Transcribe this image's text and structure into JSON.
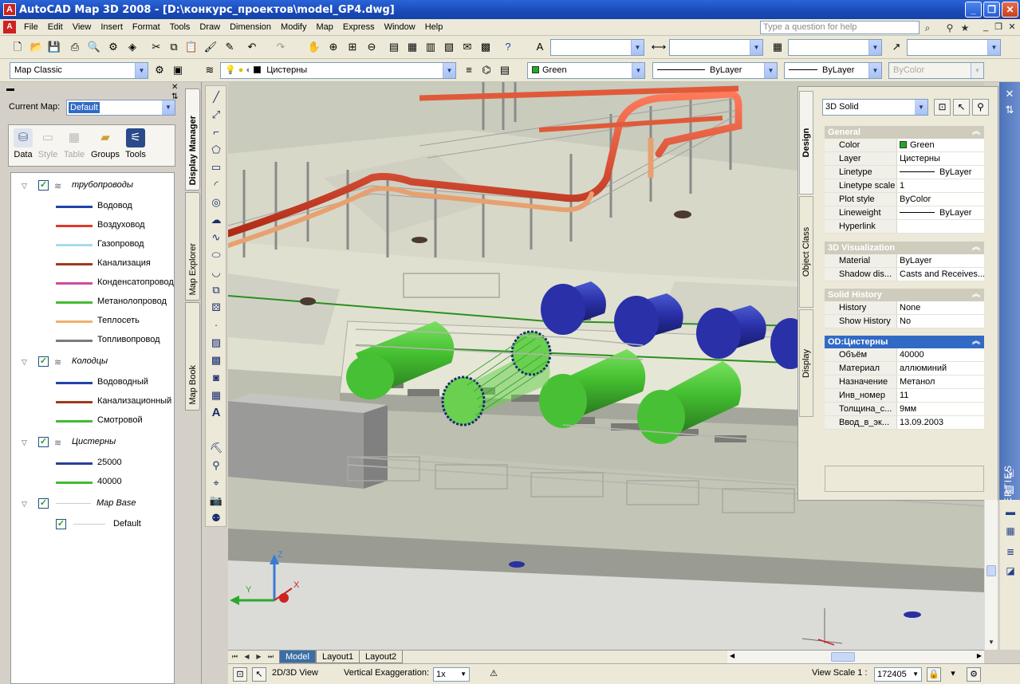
{
  "window": {
    "title": "AutoCAD Map 3D 2008 - [D:\\конкурс_проектов\\model_GP4.dwg]",
    "app_icon": "A",
    "buttons": [
      "_",
      "❐",
      "✕"
    ]
  },
  "menubar": {
    "items": [
      "File",
      "Edit",
      "View",
      "Insert",
      "Format",
      "Tools",
      "Draw",
      "Dimension",
      "Modify",
      "Map",
      "Express",
      "Window",
      "Help"
    ],
    "help_placeholder": "Type a question for help"
  },
  "toolbar2": {
    "workspace": "Map Classic",
    "layer": "Цистерны",
    "color": "Green",
    "color_hex": "#22aa22",
    "linetype": "ByLayer",
    "lineweight": "ByLayer",
    "plotstyle": "ByColor"
  },
  "display_manager": {
    "tab_label": "Display Manager",
    "current_map_label": "Current Map:",
    "current_map_value": "Default",
    "tools": [
      {
        "label": "Data",
        "icon": "database-icon"
      },
      {
        "label": "Style",
        "icon": "style-icon"
      },
      {
        "label": "Table",
        "icon": "table-icon"
      },
      {
        "label": "Groups",
        "icon": "groups-icon"
      },
      {
        "label": "Tools",
        "icon": "tools-icon"
      }
    ],
    "groups": [
      {
        "name": "трубопроводы",
        "items": [
          {
            "label": "Водовод",
            "color": "#2244aa"
          },
          {
            "label": "Воздуховод",
            "color": "#e03a2a"
          },
          {
            "label": "Газопровод",
            "color": "#a8dbe8"
          },
          {
            "label": "Канализация",
            "color": "#a03a1a"
          },
          {
            "label": "Конденсатопровод",
            "color": "#d04aa0"
          },
          {
            "label": "Метанолопровод",
            "color": "#44bb33"
          },
          {
            "label": "Теплосеть",
            "color": "#f0b070"
          },
          {
            "label": "Топливопровод",
            "color": "#7a7a7a"
          }
        ]
      },
      {
        "name": "Колодцы",
        "items": [
          {
            "label": "Водоводный",
            "color": "#2244aa"
          },
          {
            "label": "Канализационный",
            "color": "#a03a1a"
          },
          {
            "label": "Смотровой",
            "color": "#44bb33"
          }
        ]
      },
      {
        "name": "Цистерны",
        "items": [
          {
            "label": "25000",
            "color": "#2a3f9a"
          },
          {
            "label": "40000",
            "color": "#44bb33"
          }
        ]
      },
      {
        "name": "Map Base",
        "items": [
          {
            "label": "Default",
            "color": "#cccccc"
          }
        ]
      }
    ]
  },
  "side_tabs": {
    "map_explorer": "Map Explorer",
    "map_book": "Map Book"
  },
  "properties": {
    "object_type": "3D Solid",
    "tabs": [
      "Design",
      "Object Class",
      "Display"
    ],
    "strip_title": "PROPERTIES",
    "sections": [
      {
        "title": "General",
        "rows": [
          {
            "key": "Color",
            "value": "Green",
            "swatch": "#22aa22"
          },
          {
            "key": "Layer",
            "value": "Цистерны"
          },
          {
            "key": "Linetype",
            "value": "ByLayer",
            "line": true
          },
          {
            "key": "Linetype scale",
            "value": "1"
          },
          {
            "key": "Plot style",
            "value": "ByColor"
          },
          {
            "key": "Lineweight",
            "value": "ByLayer",
            "line": true
          },
          {
            "key": "Hyperlink",
            "value": ""
          }
        ]
      },
      {
        "title": "3D Visualization",
        "rows": [
          {
            "key": "Material",
            "value": "ByLayer"
          },
          {
            "key": "Shadow dis...",
            "value": "Casts and Receives..."
          }
        ]
      },
      {
        "title": "Solid History",
        "rows": [
          {
            "key": "History",
            "value": "None"
          },
          {
            "key": "Show History",
            "value": "No"
          }
        ]
      },
      {
        "title": "OD:Цистерны",
        "selected": true,
        "rows": [
          {
            "key": "Объём",
            "value": "40000"
          },
          {
            "key": "Материал",
            "value": "аллюминий"
          },
          {
            "key": "Назначение",
            "value": "Метанол"
          },
          {
            "key": "Инв_номер",
            "value": "11"
          },
          {
            "key": "Толщина_с...",
            "value": "9мм"
          },
          {
            "key": "Ввод_в_эк...",
            "value": "13.09.2003"
          }
        ]
      }
    ]
  },
  "layout_tabs": [
    "Model",
    "Layout1",
    "Layout2"
  ],
  "statusbar": {
    "view_toggle": "2D/3D View",
    "vert_exag_label": "Vertical Exaggeration:",
    "vert_exag_value": "1x",
    "view_scale_label": "View Scale 1 :",
    "view_scale_value": "172405"
  },
  "ucs": {
    "x": "X",
    "y": "Y",
    "z": "Z"
  }
}
